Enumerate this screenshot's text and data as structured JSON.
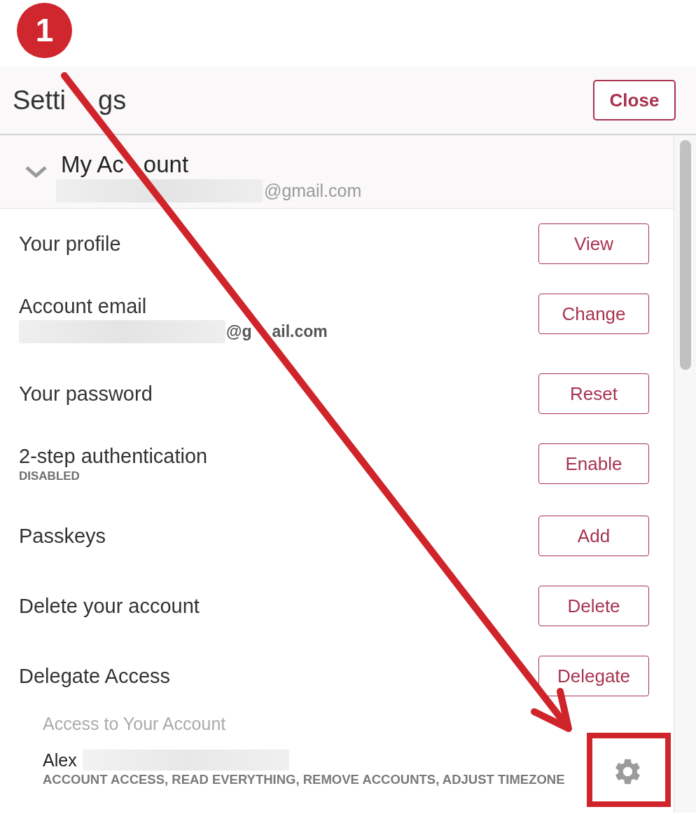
{
  "annotation": {
    "step": "1"
  },
  "header": {
    "title": {
      "before_arrow": "Setti",
      "after_arrow": "gs"
    },
    "close_button": "Close"
  },
  "section": {
    "title": {
      "before_arrow": "My Ac",
      "after_arrow": "ount"
    },
    "expanded": true,
    "email": {
      "redacted": true,
      "suffix": "@gmail.com"
    }
  },
  "rows": [
    {
      "kind": "plain",
      "label": "Your profile",
      "button": "View"
    },
    {
      "kind": "email",
      "label": "Account email",
      "email": {
        "redacted": true,
        "suffix": {
          "before_arrow": "@g",
          "after_arrow": "ail.com"
        }
      },
      "button": "Change"
    },
    {
      "kind": "plain",
      "label": "Your password",
      "button": "Reset"
    },
    {
      "kind": "status",
      "label": "2-step authentication",
      "status": "DISABLED",
      "button": "Enable"
    },
    {
      "kind": "plain",
      "label": "Passkeys",
      "button": "Add"
    },
    {
      "kind": "plain",
      "label": "Delete your account",
      "button": "Delete"
    },
    {
      "kind": "plain",
      "label": "Delegate Access",
      "button": "Delegate"
    }
  ],
  "delegates": {
    "heading": "Access to Your Account",
    "items": [
      {
        "name": "Alex",
        "redacted": true,
        "permissions": "ACCOUNT ACCESS, READ EVERYTHING, REMOVE ACCOUNTS, ADJUST TIMEZONE"
      }
    ]
  }
}
